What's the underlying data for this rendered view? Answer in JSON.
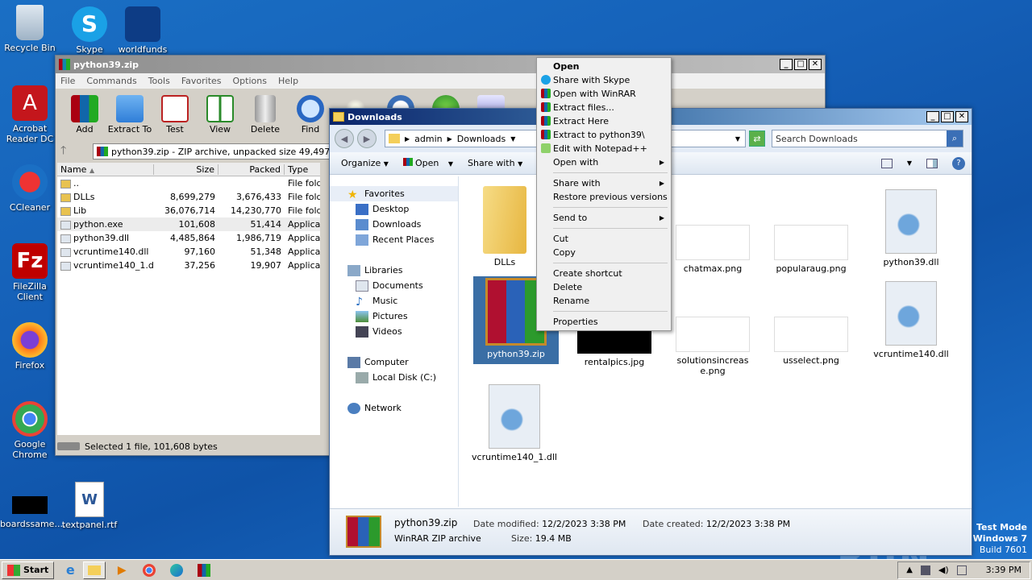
{
  "desktop": {
    "icons": [
      {
        "label": "Recycle Bin"
      },
      {
        "label": "Skype"
      },
      {
        "label": "worldfunds"
      },
      {
        "label": "Acrobat Reader DC"
      },
      {
        "label": "CCleaner"
      },
      {
        "label": "FileZilla Client"
      },
      {
        "label": "Firefox"
      },
      {
        "label": "Google Chrome"
      },
      {
        "label": "boardssame...."
      },
      {
        "label": "textpanel.rtf"
      }
    ],
    "watermark": "ANY RUN",
    "test_mode": {
      "line1": "Test Mode",
      "line2": "Windows 7",
      "line3": "Build 7601"
    }
  },
  "winrar": {
    "title": "python39.zip",
    "menu": [
      "File",
      "Commands",
      "Tools",
      "Favorites",
      "Options",
      "Help"
    ],
    "toolbar": [
      "Add",
      "Extract To",
      "Test",
      "View",
      "Delete",
      "Find"
    ],
    "path": "python39.zip - ZIP archive, unpacked size 49,497,881",
    "columns": [
      "Name",
      "Size",
      "Packed",
      "Type"
    ],
    "rows": [
      {
        "name": "..",
        "size": "",
        "packed": "",
        "type": "File fold"
      },
      {
        "name": "DLLs",
        "size": "8,699,279",
        "packed": "3,676,433",
        "type": "File fold"
      },
      {
        "name": "Lib",
        "size": "36,076,714",
        "packed": "14,230,770",
        "type": "File fold"
      },
      {
        "name": "python.exe",
        "size": "101,608",
        "packed": "51,414",
        "type": "Applicat"
      },
      {
        "name": "python39.dll",
        "size": "4,485,864",
        "packed": "1,986,719",
        "type": "Applicat"
      },
      {
        "name": "vcruntime140.dll",
        "size": "97,160",
        "packed": "51,348",
        "type": "Applicat"
      },
      {
        "name": "vcruntime140_1.dll",
        "size": "37,256",
        "packed": "19,907",
        "type": "Applicat"
      }
    ],
    "status": "Selected 1 file, 101,608 bytes"
  },
  "explorer": {
    "title": "Downloads",
    "breadcrumb": [
      "admin",
      "Downloads"
    ],
    "search_placeholder": "Search Downloads",
    "commands": [
      "Organize",
      "Open",
      "Share with"
    ],
    "nav": {
      "favorites": "Favorites",
      "fav_items": [
        "Desktop",
        "Downloads",
        "Recent Places"
      ],
      "libraries": "Libraries",
      "lib_items": [
        "Documents",
        "Music",
        "Pictures",
        "Videos"
      ],
      "computer": "Computer",
      "comp_items": [
        "Local Disk (C:)"
      ],
      "network": "Network"
    },
    "files": [
      {
        "name": "DLLs"
      },
      {
        "name": "chatmax.png"
      },
      {
        "name": "popularaug.png"
      },
      {
        "name": "python39.dll"
      },
      {
        "name": "python39.zip"
      },
      {
        "name": "rentalpics.jpg"
      },
      {
        "name": "solutionsincrease.png"
      },
      {
        "name": "usselect.png"
      },
      {
        "name": "vcruntime140.dll"
      },
      {
        "name": "vcruntime140_1.dll"
      }
    ],
    "details": {
      "name": "python39.zip",
      "type": "WinRAR ZIP archive",
      "modified_label": "Date modified:",
      "modified": "12/2/2023 3:38 PM",
      "created_label": "Date created:",
      "created": "12/2/2023 3:38 PM",
      "size_label": "Size:",
      "size": "19.4 MB"
    }
  },
  "context_menu": {
    "items": [
      "Open",
      "Share with Skype",
      "Open with WinRAR",
      "Extract files...",
      "Extract Here",
      "Extract to python39\\",
      "Edit with Notepad++",
      "Open with",
      "Share with",
      "Restore previous versions",
      "Send to",
      "Cut",
      "Copy",
      "Create shortcut",
      "Delete",
      "Rename",
      "Properties"
    ]
  },
  "taskbar": {
    "start": "Start",
    "time": "3:39 PM"
  }
}
